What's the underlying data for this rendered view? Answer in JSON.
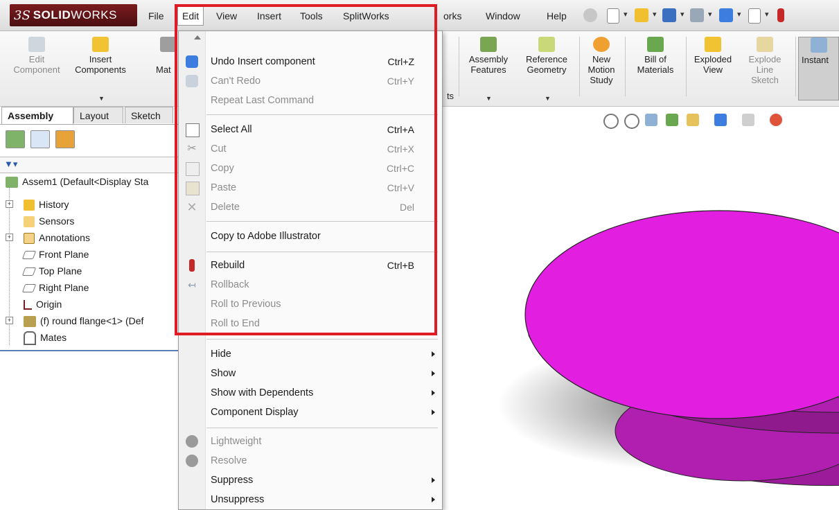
{
  "app": {
    "logo_prefix": "3S",
    "logo_bold": "SOLID",
    "logo_light": "WORKS"
  },
  "menubar": {
    "items": [
      "File",
      "Edit",
      "View",
      "Insert",
      "Tools",
      "SplitWorks",
      "MoldWorks",
      "Window",
      "Help"
    ],
    "active": "Edit"
  },
  "ribbon": {
    "left_buttons": [
      {
        "label": "Edit\nComponent",
        "icon": "edit-component-icon"
      },
      {
        "label": "Insert\nComponents",
        "icon": "insert-components-icon"
      },
      {
        "label": "Mat",
        "icon": "mate-icon"
      }
    ],
    "partial_label": "ts",
    "right_buttons": [
      {
        "label": "Assembly\nFeatures",
        "icon": "assembly-features-icon"
      },
      {
        "label": "Reference\nGeometry",
        "icon": "reference-geometry-icon"
      },
      {
        "label": "New\nMotion\nStudy",
        "icon": "motion-study-icon"
      },
      {
        "label": "Bill of\nMaterials",
        "icon": "bill-of-materials-icon"
      },
      {
        "label": "Exploded\nView",
        "icon": "exploded-view-icon"
      },
      {
        "label": "Explode\nLine\nSketch",
        "icon": "explode-line-sketch-icon"
      },
      {
        "label": "Instant",
        "icon": "instant3d-icon"
      }
    ]
  },
  "left_panel": {
    "tabs": [
      "Assembly",
      "Layout",
      "Sketch"
    ],
    "selected_tab": "Assembly",
    "tree": [
      {
        "label": "Assem1  (Default<Display Sta",
        "icon": "assembly-icon"
      },
      {
        "label": "History",
        "icon": "history-icon"
      },
      {
        "label": "Sensors",
        "icon": "sensors-icon"
      },
      {
        "label": "Annotations",
        "icon": "annotations-icon"
      },
      {
        "label": "Front Plane",
        "icon": "plane-icon"
      },
      {
        "label": "Top Plane",
        "icon": "plane-icon"
      },
      {
        "label": "Right Plane",
        "icon": "plane-icon"
      },
      {
        "label": "Origin",
        "icon": "origin-icon"
      },
      {
        "label": "(f) round flange<1> (Def",
        "icon": "part-icon"
      },
      {
        "label": "Mates",
        "icon": "mates-icon"
      }
    ]
  },
  "edit_menu": {
    "items": [
      {
        "label": "Undo Insert component",
        "shortcut": "Ctrl+Z",
        "enabled": true,
        "icon": "undo-icon"
      },
      {
        "label": "Can't Redo",
        "shortcut": "Ctrl+Y",
        "enabled": false,
        "icon": "redo-icon"
      },
      {
        "label": "Repeat Last Command",
        "shortcut": "",
        "enabled": false,
        "icon": ""
      },
      {
        "label": "Select All",
        "shortcut": "Ctrl+A",
        "enabled": true,
        "icon": "select-all-icon"
      },
      {
        "label": "Cut",
        "shortcut": "Ctrl+X",
        "enabled": false,
        "icon": "cut-icon"
      },
      {
        "label": "Copy",
        "shortcut": "Ctrl+C",
        "enabled": false,
        "icon": "copy-icon"
      },
      {
        "label": "Paste",
        "shortcut": "Ctrl+V",
        "enabled": false,
        "icon": "paste-icon"
      },
      {
        "label": "Delete",
        "shortcut": "Del",
        "enabled": false,
        "icon": "delete-icon"
      },
      {
        "label": "Copy to Adobe Illustrator",
        "shortcut": "",
        "enabled": true,
        "icon": ""
      },
      {
        "label": "Rebuild",
        "shortcut": "Ctrl+B",
        "enabled": true,
        "icon": "rebuild-icon"
      },
      {
        "label": "Rollback",
        "shortcut": "",
        "enabled": false,
        "icon": "rollback-icon"
      },
      {
        "label": "Roll to Previous",
        "shortcut": "",
        "enabled": false,
        "icon": ""
      },
      {
        "label": "Roll to End",
        "shortcut": "",
        "enabled": false,
        "icon": ""
      },
      {
        "label": "Hide",
        "shortcut": "",
        "enabled": true,
        "icon": "",
        "submenu": true
      },
      {
        "label": "Show",
        "shortcut": "",
        "enabled": true,
        "icon": "",
        "submenu": true
      },
      {
        "label": "Show with Dependents",
        "shortcut": "",
        "enabled": true,
        "icon": "",
        "submenu": true
      },
      {
        "label": "Component Display",
        "shortcut": "",
        "enabled": true,
        "icon": "",
        "submenu": true
      },
      {
        "label": "Lightweight",
        "shortcut": "",
        "enabled": false,
        "icon": "lightweight-icon"
      },
      {
        "label": "Resolve",
        "shortcut": "",
        "enabled": false,
        "icon": "resolve-icon"
      },
      {
        "label": "Suppress",
        "shortcut": "",
        "enabled": true,
        "icon": "",
        "submenu": true
      },
      {
        "label": "Unsuppress",
        "shortcut": "",
        "enabled": true,
        "icon": "",
        "submenu": true
      }
    ]
  },
  "colors": {
    "highlight": "#e01b24",
    "model_fill": "#e21ee0",
    "logo_bg": "#6b1619"
  }
}
